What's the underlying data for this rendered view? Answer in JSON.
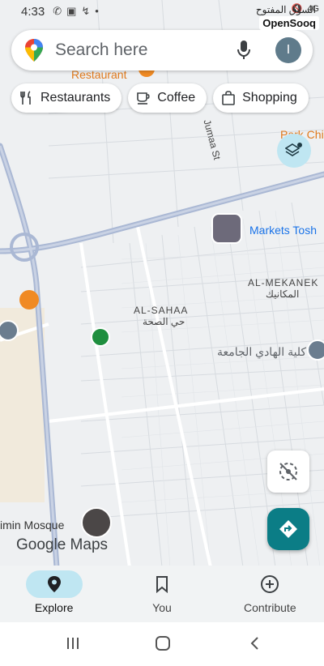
{
  "status": {
    "time": "4:33",
    "network": "4G",
    "watermark": "OpenSooq",
    "watermark_ar": "السوق المفتوح"
  },
  "search": {
    "placeholder": "Search here",
    "avatar_letter": "I"
  },
  "chips": [
    {
      "label": "Restaurants",
      "icon": "fork-knife-icon"
    },
    {
      "label": "Coffee",
      "icon": "coffee-icon"
    },
    {
      "label": "Shopping",
      "icon": "shopping-bag-icon"
    }
  ],
  "map": {
    "labels": {
      "restaurant": "Restaurant",
      "markets": "Markets Tosh",
      "mekanek_en": "AL-MEKANEK",
      "mekanek_ar": "المكانيك",
      "sahaa_en": "AL-SAHAA",
      "sahaa_ar": "حي الصحة",
      "college": "كلية الهادي الجامعة",
      "mosque": "imin Mosque",
      "street": "Jumaa St",
      "chip_partial": "Park Chi"
    },
    "logo": "Google Maps"
  },
  "nav": [
    {
      "label": "Explore",
      "icon": "explore-pin-icon",
      "active": true
    },
    {
      "label": "You",
      "icon": "bookmark-icon",
      "active": false
    },
    {
      "label": "Contribute",
      "icon": "add-circle-icon",
      "active": false
    }
  ],
  "colors": {
    "accent": "#0b7d86",
    "active_pill": "#bfe6f2",
    "road_major": "#aab8d4"
  }
}
